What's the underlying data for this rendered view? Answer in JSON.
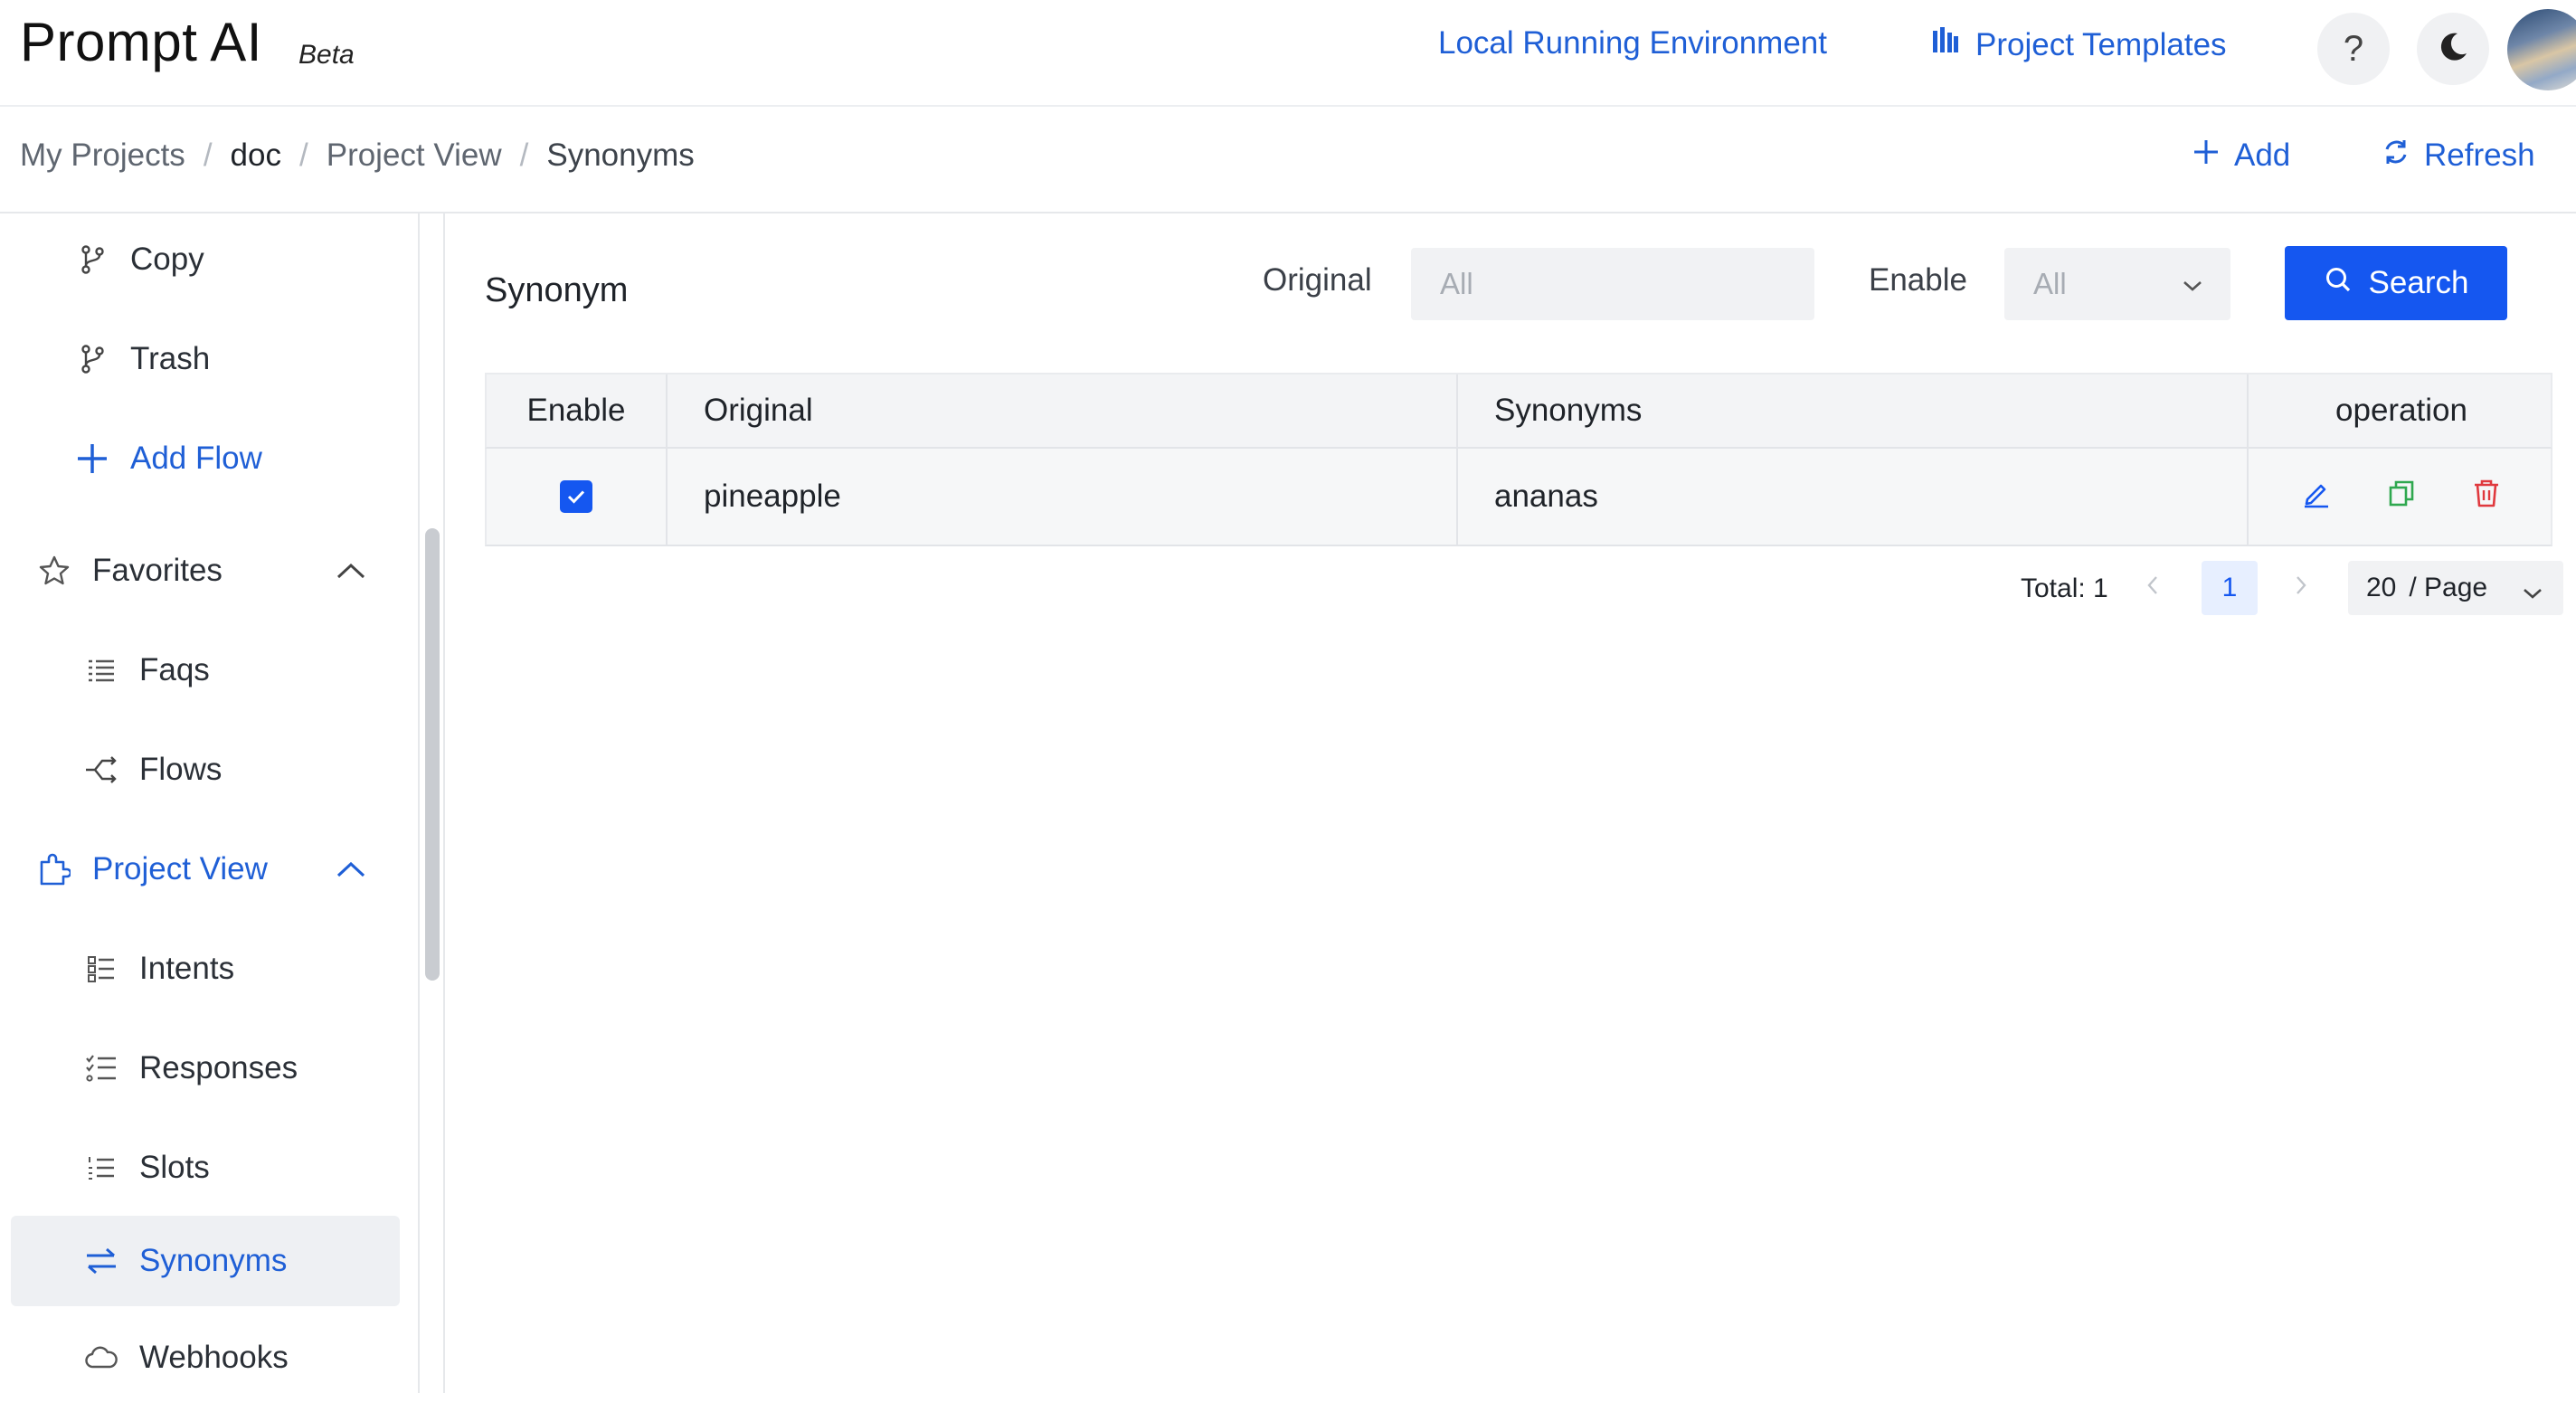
{
  "header": {
    "logo_text": "Prompt AI",
    "logo_badge": "Beta",
    "env_link": "Local Running Environment",
    "templates_link": "Project Templates",
    "help_glyph": "?",
    "icons": {
      "templates": "bar-library-icon",
      "help": "question-icon",
      "theme": "moon-icon",
      "avatar": "user-avatar"
    }
  },
  "breadcrumb": {
    "items": [
      "My Projects",
      "doc",
      "Project View",
      "Synonyms"
    ],
    "separator": "/"
  },
  "actions": {
    "add_label": "Add",
    "refresh_label": "Refresh"
  },
  "sidebar": {
    "items": [
      {
        "label": "Copy",
        "icon": "branch-icon"
      },
      {
        "label": "Trash",
        "icon": "branch-icon"
      },
      {
        "label": "Add Flow",
        "icon": "plus-icon"
      },
      {
        "label": "Favorites",
        "icon": "star-icon"
      },
      {
        "label": "Faqs",
        "icon": "faq-list-icon"
      },
      {
        "label": "Flows",
        "icon": "flow-icon"
      },
      {
        "label": "Project View",
        "icon": "puzzle-icon"
      },
      {
        "label": "Intents",
        "icon": "intent-list-icon"
      },
      {
        "label": "Responses",
        "icon": "checklist-icon"
      },
      {
        "label": "Slots",
        "icon": "numbered-list-icon"
      },
      {
        "label": "Synonyms",
        "icon": "swap-arrows-icon"
      },
      {
        "label": "Webhooks",
        "icon": "cloud-icon"
      }
    ],
    "active": "Synonyms"
  },
  "panel": {
    "title": "Synonym",
    "filter_original_label": "Original",
    "filter_original_placeholder": "All",
    "filter_enable_label": "Enable",
    "filter_enable_value": "All",
    "search_label": "Search"
  },
  "table": {
    "columns": [
      "Enable",
      "Original",
      "Synonyms",
      "operation"
    ],
    "rows": [
      {
        "enabled": true,
        "original": "pineapple",
        "synonyms": "ananas"
      }
    ],
    "row_actions": [
      "edit-icon",
      "copy-icon",
      "delete-icon"
    ]
  },
  "pagination": {
    "total_label": "Total: 1",
    "current_page": "1",
    "page_size": "20",
    "page_size_suffix": "/ Page"
  },
  "colors": {
    "accent": "#1557f0",
    "link": "#1f5fd6",
    "copy_action": "#2fa84f",
    "delete_action": "#e0393e"
  }
}
